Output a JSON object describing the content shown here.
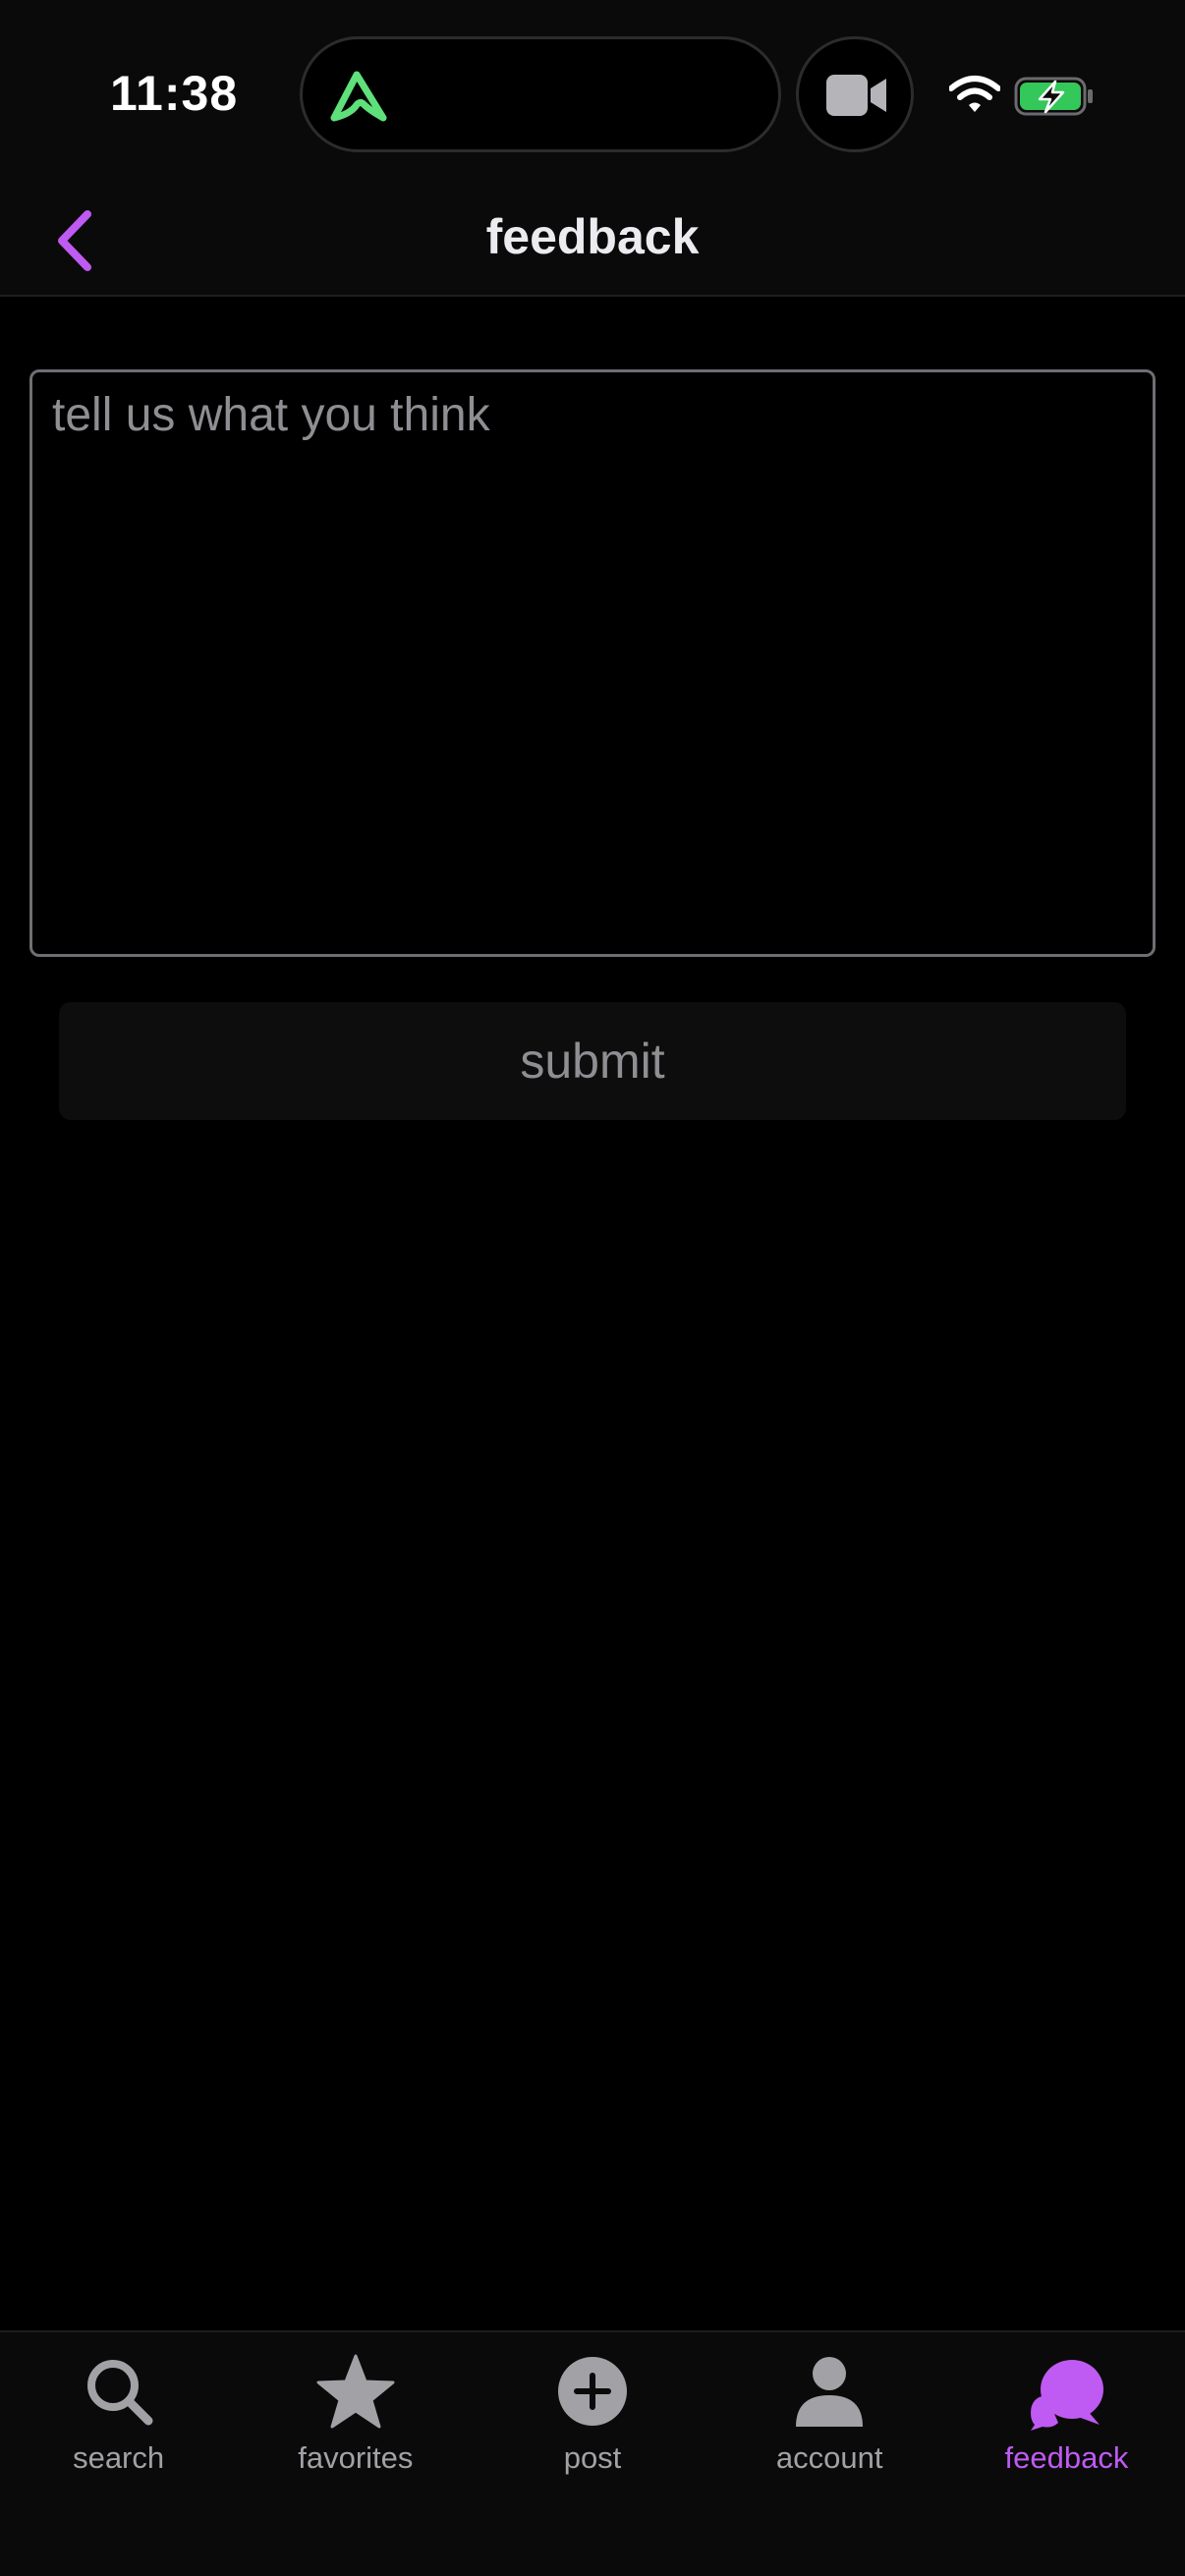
{
  "status_bar": {
    "time": "11:38",
    "island_icon": "mountain-logo-icon",
    "camera_icon": "video-camera-icon",
    "wifi_icon": "wifi-icon",
    "battery_icon": "battery-charging-icon"
  },
  "header": {
    "title": "feedback",
    "back_icon": "chevron-left-icon"
  },
  "form": {
    "placeholder": "tell us what you think",
    "value": "",
    "submit_label": "submit"
  },
  "tabs": [
    {
      "label": "search",
      "icon": "search-icon",
      "active": false
    },
    {
      "label": "favorites",
      "icon": "star-icon",
      "active": false
    },
    {
      "label": "post",
      "icon": "plus-circle-icon",
      "active": false
    },
    {
      "label": "account",
      "icon": "person-icon",
      "active": false
    },
    {
      "label": "feedback",
      "icon": "chat-bubbles-icon",
      "active": true
    }
  ],
  "colors": {
    "accent": "#bf5af2",
    "island_logo": "#5ee07a",
    "battery_fill": "#34c759",
    "inactive": "#a1a1a6",
    "background": "#000000"
  }
}
